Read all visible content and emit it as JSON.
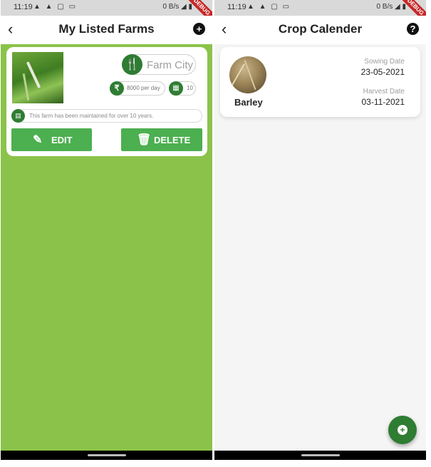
{
  "left_screen": {
    "status_bar": {
      "time": "11:19",
      "network": "0 B/s",
      "debug_banner": "DEBUG"
    },
    "app_bar": {
      "title": "My Listed Farms",
      "back_icon": "‹",
      "action_icon": "+"
    },
    "farm_card": {
      "type_icon": "🍴",
      "type_placeholder": "Farm City",
      "price_symbol": "₹",
      "price": "8000 per day",
      "area_icon": "▦",
      "area": "10",
      "description_icon": "▤",
      "description": "This farm has been maintained for over 10 years.",
      "edit_icon": "✎",
      "edit_label": "EDIT",
      "delete_icon": "🗑",
      "delete_label": "DELETE"
    }
  },
  "right_screen": {
    "status_bar": {
      "time": "11:19",
      "network": "0 B/s",
      "debug_banner": "DEBUG"
    },
    "app_bar": {
      "title": "Crop Calender",
      "back_icon": "‹",
      "help_icon": "?"
    },
    "crop_card": {
      "name": "Barley",
      "sowing_label": "Sowing Date",
      "sowing_date": "23-05-2021",
      "harvest_label": "Harvest Date",
      "harvest_date": "03-11-2021"
    },
    "fab_icon": "+"
  },
  "colors": {
    "left_background": "#8bc34a",
    "accent_dark_green": "#2e7d32",
    "button_green": "#4caf50"
  }
}
